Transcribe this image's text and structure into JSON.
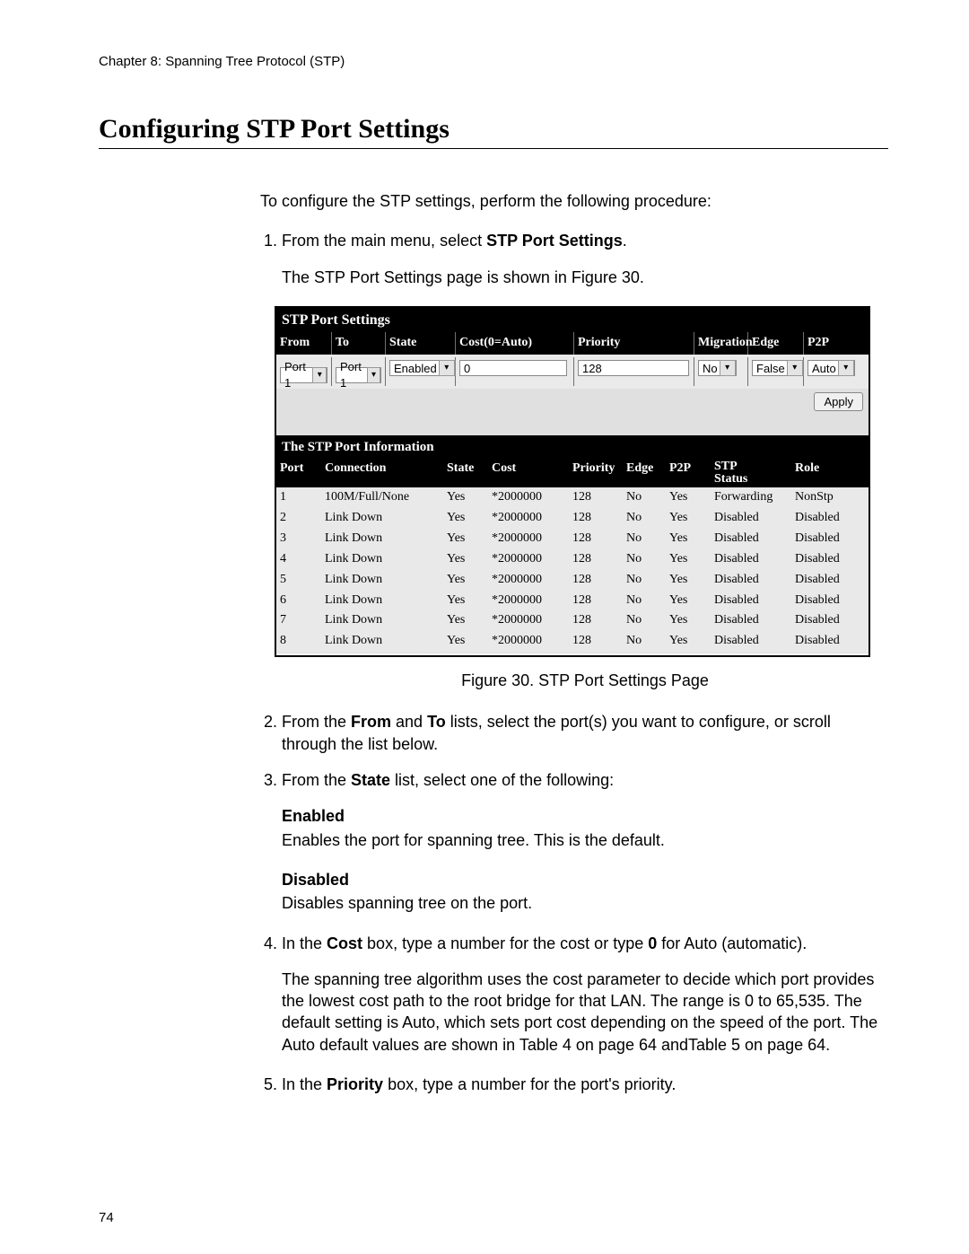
{
  "chapter_line": "Chapter 8: Spanning Tree Protocol (STP)",
  "section_title": "Configuring STP Port Settings",
  "intro_line": "To configure the STP settings, perform the following procedure:",
  "step1_prefix": "From the main menu, select ",
  "step1_bold": "STP Port Settings",
  "step1_suffix": ".",
  "step1_result": "The STP Port Settings page is shown in Figure 30.",
  "figure_caption": "Figure 30. STP Port Settings Page",
  "step2_prefix": "From the ",
  "step2_b1": "From",
  "step2_mid1": " and ",
  "step2_b2": "To",
  "step2_suffix": " lists, select the port(s) you want to configure, or scroll through the list below.",
  "step3_prefix": "From the ",
  "step3_bold": "State",
  "step3_suffix": " list, select one of the following:",
  "state_enabled_head": "Enabled",
  "state_enabled_desc": "Enables the port for spanning tree. This is the default.",
  "state_disabled_head": "Disabled",
  "state_disabled_desc": "Disables spanning tree on the port.",
  "step4_prefix": "In the ",
  "step4_b1": "Cost",
  "step4_mid": " box, type a number for the cost or type ",
  "step4_b2": "0",
  "step4_suffix": " for Auto (automatic).",
  "step4_para": "The spanning tree algorithm uses the cost parameter to decide which port provides the lowest cost path to the root bridge for that LAN. The range is 0 to 65,535. The default setting is Auto, which sets port cost depending on the speed of the port. The Auto default values are shown in Table 4 on page 64 andTable 5 on page 64.",
  "step5_prefix": "In the ",
  "step5_bold": "Priority",
  "step5_suffix": " box, type a number for the port's priority.",
  "page_number": "74",
  "screenshot": {
    "title": "STP Port Settings",
    "headers": {
      "from": "From",
      "to": "To",
      "state": "State",
      "cost": "Cost(0=Auto)",
      "priority": "Priority",
      "migration": "Migration",
      "edge": "Edge",
      "p2p": "P2P"
    },
    "form": {
      "from": "Port 1",
      "to": "Port 1",
      "state": "Enabled",
      "cost": "0",
      "priority": "128",
      "migration": "No",
      "edge": "False",
      "p2p": "Auto",
      "apply": "Apply"
    },
    "info_title": "The STP Port Information",
    "info_headers": {
      "port": "Port",
      "connection": "Connection",
      "state": "State",
      "cost": "Cost",
      "priority": "Priority",
      "edge": "Edge",
      "p2p": "P2P",
      "stp_status_a": "STP",
      "stp_status_b": "Status",
      "role": "Role"
    },
    "rows": [
      {
        "port": "1",
        "connection": "100M/Full/None",
        "state": "Yes",
        "cost": "*2000000",
        "priority": "128",
        "edge": "No",
        "p2p": "Yes",
        "stp": "Forwarding",
        "role": "NonStp"
      },
      {
        "port": "2",
        "connection": "Link Down",
        "state": "Yes",
        "cost": "*2000000",
        "priority": "128",
        "edge": "No",
        "p2p": "Yes",
        "stp": "Disabled",
        "role": "Disabled"
      },
      {
        "port": "3",
        "connection": "Link Down",
        "state": "Yes",
        "cost": "*2000000",
        "priority": "128",
        "edge": "No",
        "p2p": "Yes",
        "stp": "Disabled",
        "role": "Disabled"
      },
      {
        "port": "4",
        "connection": "Link Down",
        "state": "Yes",
        "cost": "*2000000",
        "priority": "128",
        "edge": "No",
        "p2p": "Yes",
        "stp": "Disabled",
        "role": "Disabled"
      },
      {
        "port": "5",
        "connection": "Link Down",
        "state": "Yes",
        "cost": "*2000000",
        "priority": "128",
        "edge": "No",
        "p2p": "Yes",
        "stp": "Disabled",
        "role": "Disabled"
      },
      {
        "port": "6",
        "connection": "Link Down",
        "state": "Yes",
        "cost": "*2000000",
        "priority": "128",
        "edge": "No",
        "p2p": "Yes",
        "stp": "Disabled",
        "role": "Disabled"
      },
      {
        "port": "7",
        "connection": "Link Down",
        "state": "Yes",
        "cost": "*2000000",
        "priority": "128",
        "edge": "No",
        "p2p": "Yes",
        "stp": "Disabled",
        "role": "Disabled"
      },
      {
        "port": "8",
        "connection": "Link Down",
        "state": "Yes",
        "cost": "*2000000",
        "priority": "128",
        "edge": "No",
        "p2p": "Yes",
        "stp": "Disabled",
        "role": "Disabled"
      }
    ]
  }
}
